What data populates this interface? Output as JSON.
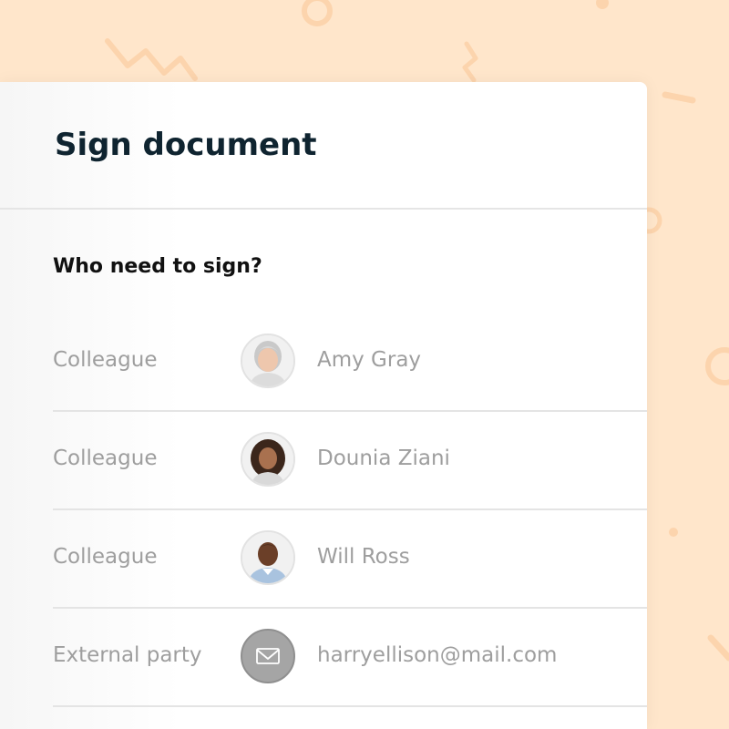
{
  "dialog": {
    "title": "Sign document"
  },
  "signers_section": {
    "heading": "Who need to sign?",
    "rows": [
      {
        "role": "Colleague",
        "name": "Amy Gray"
      },
      {
        "role": "Colleague",
        "name": "Dounia Ziani"
      },
      {
        "role": "Colleague",
        "name": "Will Ross"
      },
      {
        "role": "External party",
        "name": "harryellison@mail.com"
      }
    ]
  },
  "colors": {
    "background": "#ffe6cb",
    "decoration": "#fcd4ad",
    "title_text": "#0f2430",
    "muted_text": "#9e9e9e",
    "divider": "#e4e4e4",
    "email_avatar": "#a5a5a5"
  },
  "icons": {
    "email_avatar_icon": "envelope-icon"
  }
}
